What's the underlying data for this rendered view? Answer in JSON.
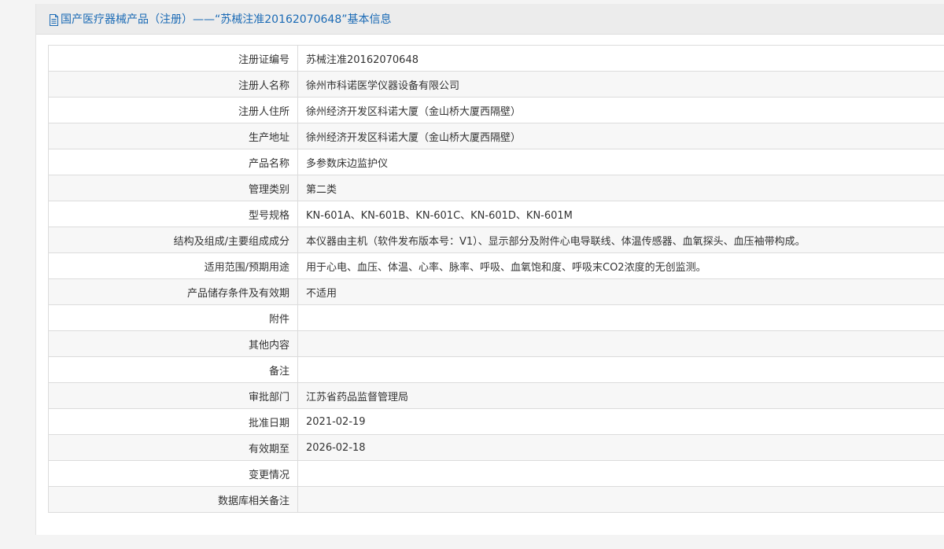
{
  "header": {
    "icon": "document-icon",
    "title": "国产医疗器械产品（注册）——“苏械注准20162070648”基本信息",
    "accent_color": "#1a6ab5"
  },
  "rows": [
    {
      "label": "注册证编号",
      "value": "苏械注准20162070648"
    },
    {
      "label": "注册人名称",
      "value": "徐州市科诺医学仪器设备有限公司"
    },
    {
      "label": "注册人住所",
      "value": "徐州经济开发区科诺大厦（金山桥大厦西隔壁）"
    },
    {
      "label": "生产地址",
      "value": "徐州经济开发区科诺大厦（金山桥大厦西隔壁）"
    },
    {
      "label": "产品名称",
      "value": "多参数床边监护仪"
    },
    {
      "label": "管理类别",
      "value": "第二类"
    },
    {
      "label": "型号规格",
      "value": "KN-601A、KN-601B、KN-601C、KN-601D、KN-601M"
    },
    {
      "label": "结构及组成/主要组成成分",
      "value": "本仪器由主机（软件发布版本号：V1）、显示部分及附件心电导联线、体温传感器、血氧探头、血压袖带构成。"
    },
    {
      "label": "适用范围/预期用途",
      "value": "用于心电、血压、体温、心率、脉率、呼吸、血氧饱和度、呼吸末CO2浓度的无创监测。"
    },
    {
      "label": "产品储存条件及有效期",
      "value": "不适用"
    },
    {
      "label": "附件",
      "value": ""
    },
    {
      "label": "其他内容",
      "value": ""
    },
    {
      "label": "备注",
      "value": ""
    },
    {
      "label": "审批部门",
      "value": "江苏省药品监督管理局"
    },
    {
      "label": "批准日期",
      "value": "2021-02-19"
    },
    {
      "label": "有效期至",
      "value": "2026-02-18"
    },
    {
      "label": "变更情况",
      "value": ""
    },
    {
      "label": "数据库相关备注",
      "value": ""
    }
  ]
}
